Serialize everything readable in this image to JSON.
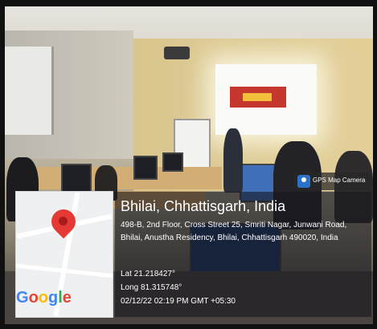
{
  "gps_badge": {
    "label": "GPS Map Camera",
    "icon": "gps-map-camera-icon"
  },
  "map": {
    "logo_text": "Google",
    "pin_color": "#e53935",
    "icon": "map-pin-icon"
  },
  "location": {
    "title": "Bhilai, Chhattisgarh, India",
    "address": "498-B, 2nd Floor, Cross Street 25, Smriti Nagar, Junwani Road, Bhilai, Anustha Residency, Bhilai, Chhattisgarh 490020, India",
    "latitude": "Lat 21.218427°",
    "longitude": "Long 81.315748°",
    "timestamp": "02/12/22 02:19 PM GMT +05:30"
  }
}
